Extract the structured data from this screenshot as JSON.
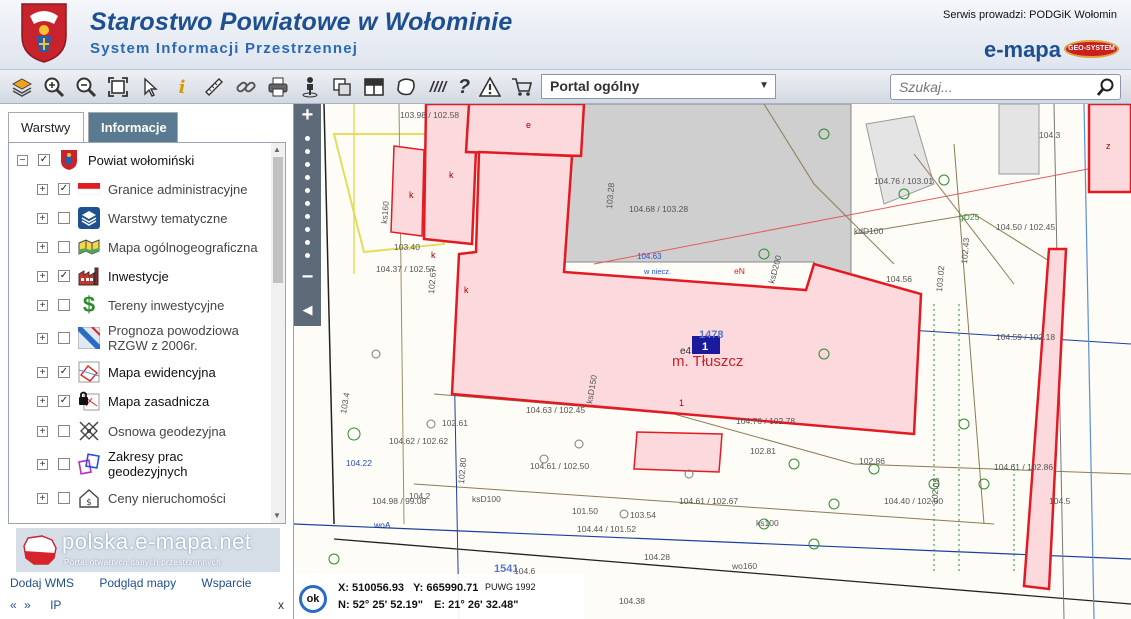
{
  "header": {
    "title": "Starostwo Powiatowe w Wołominie",
    "subtitle": "System Informacji Przestrzennej",
    "service_label": "Serwis prowadzi:  PODGiK Wołomin",
    "brand": "e-mapa",
    "badge": "GEO-SYSTEM"
  },
  "toolbar": {
    "portal_selected": "Portal ogólny",
    "search_placeholder": "Szukaj..."
  },
  "tabs": [
    {
      "label": "Warstwy",
      "active": true
    },
    {
      "label": "Informacje",
      "active": false
    }
  ],
  "layers": [
    {
      "name": "Powiat wołomiński",
      "checked": true,
      "expander": "−",
      "icon": "powiat-crest-icon"
    },
    {
      "name": "Granice administracyjne",
      "checked": true,
      "expander": "+",
      "icon": "boundary-flag-icon"
    },
    {
      "name": "Warstwy tematyczne",
      "checked": false,
      "expander": "+",
      "icon": "layers-stack-icon"
    },
    {
      "name": "Mapa ogólnogeograficzna",
      "checked": false,
      "expander": "+",
      "icon": "general-map-icon"
    },
    {
      "name": "Inwestycje",
      "checked": true,
      "expander": "+",
      "icon": "factory-icon"
    },
    {
      "name": "Tereny inwestycyjne",
      "checked": false,
      "expander": "+",
      "icon": "dollar-icon"
    },
    {
      "name": "Prognoza powodziowa RZGW z 2006r.",
      "checked": false,
      "expander": "+",
      "icon": "flood-icon"
    },
    {
      "name": "Mapa ewidencyjna",
      "checked": true,
      "expander": "+",
      "icon": "cadastral-map-icon"
    },
    {
      "name": "Mapa zasadnicza",
      "checked": true,
      "expander": "+",
      "icon": "basemap-lock-icon"
    },
    {
      "name": "Osnowa geodezyjna",
      "checked": false,
      "expander": "+",
      "icon": "geodetic-control-icon"
    },
    {
      "name": "Zakresy prac geodezyjnych",
      "checked": false,
      "expander": "+",
      "icon": "work-extent-icon"
    },
    {
      "name": "Ceny nieruchomości",
      "checked": false,
      "expander": "+",
      "icon": "property-price-icon"
    }
  ],
  "banner": {
    "brand": "polska.e-mapa.net",
    "tagline": "Portal otwartych danych przestrzennych"
  },
  "links": [
    "Dodaj WMS",
    "Podgląd mapy",
    "Wsparcie"
  ],
  "bottom_nav": {
    "prev": "«",
    "next": "»",
    "ip": "IP",
    "close": "x"
  },
  "coords": {
    "x": "X: 510056.93",
    "y": "Y: 665990.71",
    "crs": "PUWG 1992",
    "n": "N: 52° 25' 52.19\"",
    "e": "E: 21° 26' 32.48\"",
    "ok": "ok"
  },
  "map": {
    "town_label": "m. Tłuszcz",
    "parcel_number": "1478",
    "parcel_badge": "1",
    "parcel_small": "1",
    "building_e4": "e4",
    "parcel_1541": "1541",
    "labels": [
      "e",
      "k",
      "k",
      "k",
      "k",
      "z",
      "104.68 / 103.28",
      "104.63",
      "w niecz.",
      "104.56",
      "104.76 / 103.01",
      "104.50 / 102.45",
      "104.59 / 102.18",
      "104.37 / 102.57",
      "104.63 / 102.45",
      "104.62 / 102.62",
      "104.61 / 102.50",
      "104.76 / 102.78",
      "102.81",
      "102.86",
      "104.61 / 102.86",
      "104.98 / 99.08",
      "104.61 / 102.67",
      "104.40 / 102.00",
      "104.44 / 101.52",
      "101.50",
      "103.54",
      "102.61",
      "104.22",
      "104.2",
      "104.28",
      "104.38",
      "kdD100",
      "ksD100",
      "ksD200",
      "ksD150",
      "ks100",
      "ks160",
      "wo160",
      "woA",
      "eN",
      "gD25",
      "103.40",
      "103.98 / 102.58",
      "103.28",
      "103.02",
      "102.80",
      "102.67",
      "102.43",
      "102.05",
      "103.4",
      "104.3",
      "104.5",
      "104.6"
    ]
  }
}
